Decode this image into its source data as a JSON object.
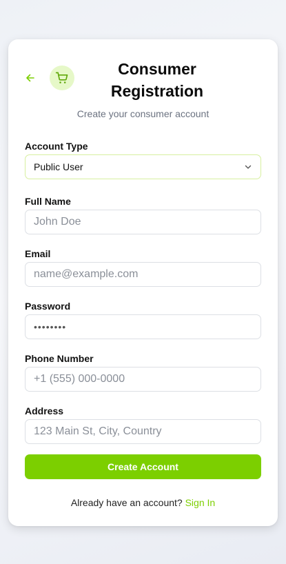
{
  "header": {
    "title_line1": "Consumer",
    "title_line2": "Registration",
    "subtitle": "Create your consumer account"
  },
  "icons": {
    "back": "arrow-left-icon",
    "brand": "shopping-cart-icon",
    "dropdown": "chevron-down-icon"
  },
  "form": {
    "account_type": {
      "label": "Account Type",
      "value": "Public User"
    },
    "full_name": {
      "label": "Full Name",
      "placeholder": "John Doe"
    },
    "email": {
      "label": "Email",
      "placeholder": "name@example.com"
    },
    "password": {
      "label": "Password",
      "value": "••••••••"
    },
    "phone": {
      "label": "Phone Number",
      "placeholder": "+1 (555) 000-0000"
    },
    "address": {
      "label": "Address",
      "placeholder": "123 Main St, City, Country"
    }
  },
  "submit": {
    "label": "Create Account"
  },
  "footer": {
    "prompt": "Already have an account?",
    "link": "Sign In"
  },
  "colors": {
    "accent": "#7ccf00",
    "accent_soft": "#e6f8c8",
    "select_border": "#d7ef9f"
  }
}
